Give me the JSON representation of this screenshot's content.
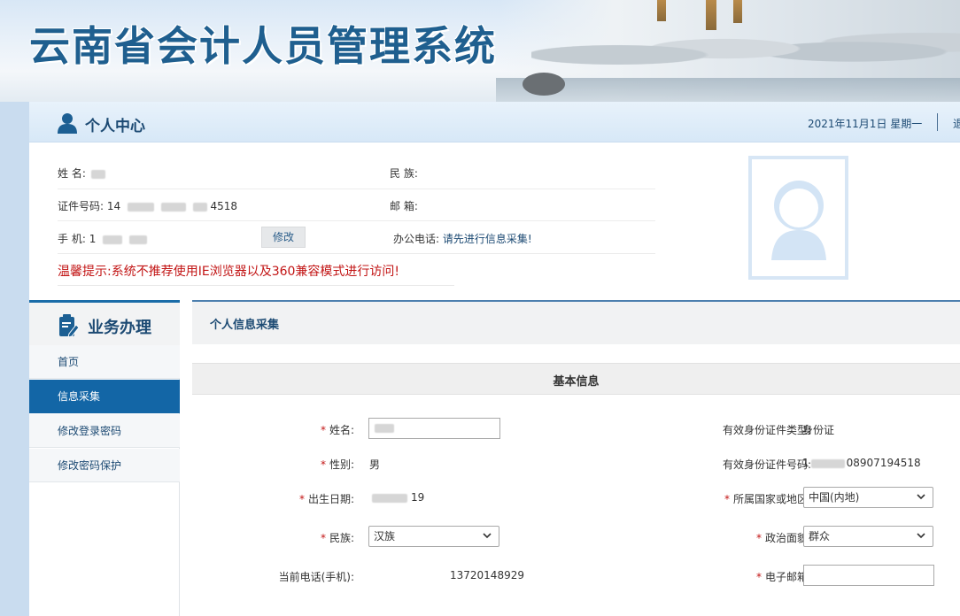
{
  "banner": {
    "title": "云南省会计人员管理系统"
  },
  "header": {
    "title": "个人中心",
    "date": "2021年11月1日 星期一",
    "logout": "退出"
  },
  "profile": {
    "name_label": "姓 名:",
    "id_label": "证件号码:",
    "id_prefix": "14",
    "id_suffix": "4518",
    "phone_label": "手 机:",
    "phone_prefix": "1",
    "edit_label": "修改",
    "nation_label": "民 族:",
    "email_label": "邮 箱:",
    "office_phone_label": "办公电话:",
    "office_phone_value": "请先进行信息采集!",
    "warning": "温馨提示:系统不推荐使用IE浏览器以及360兼容模式进行访问!"
  },
  "sidebar": {
    "title": "业务办理",
    "items": [
      {
        "label": "首页",
        "active": false
      },
      {
        "label": "信息采集",
        "active": true
      },
      {
        "label": "修改登录密码",
        "active": false
      },
      {
        "label": "修改密码保护",
        "active": false
      }
    ]
  },
  "content": {
    "page_title": "个人信息采集",
    "section_title": "基本信息",
    "required_mark": "*",
    "form": {
      "name_label": "姓名:",
      "gender_label": "性别:",
      "gender_value": "男",
      "birth_label": "出生日期:",
      "birth_suffix": "19",
      "nation_label": "民族:",
      "nation_value": "汉族",
      "phone_label": "当前电话(手机):",
      "phone_value": "13720148929",
      "id_type_label": "有效身份证件类型:",
      "id_type_value": "身份证",
      "id_number_label": "有效身份证件号码:",
      "id_number_prefix": "1",
      "id_number_suffix": "08907194518",
      "country_label": "所属国家或地区:",
      "country_value": "中国(内地)",
      "political_label": "政治面貌:",
      "political_value": "群众",
      "email_label": "电子邮箱:",
      "email_value": ""
    }
  },
  "colors": {
    "primary": "#1366a6",
    "heading": "#1c4a73",
    "warning": "#c21414",
    "frame": "#c9dcef"
  },
  "icons": {
    "header": "user-icon",
    "sidebar": "clipboard-edit-icon",
    "avatar": "avatar-placeholder-icon",
    "select": "chevron-down-icon"
  }
}
